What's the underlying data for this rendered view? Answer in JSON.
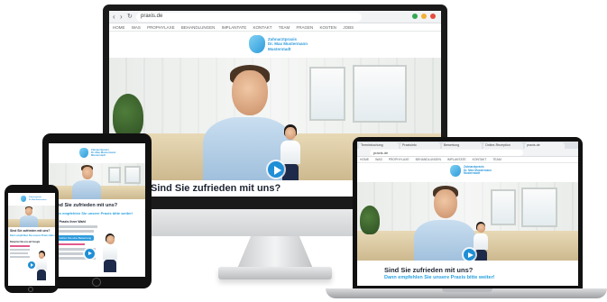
{
  "site": {
    "url": "praxis.de",
    "headline": "Sind Sie zufrieden mit uns?",
    "subline": "Dann empfehlen Sie unsere Praxis bitte weiter!",
    "logo_lines": [
      "Zahnarztpraxis",
      "Dr. Max Mustermann",
      "Musterstadt"
    ],
    "nav_items": [
      "HOME",
      "WAS",
      "PROPHYLAXE",
      "BEHANDLUNGEN",
      "IMPLANTATE",
      "KONTAKT",
      "TEAM",
      "FRAGEN",
      "KOSTEN",
      "JOBS"
    ],
    "cta_label": "Schreiben Sie eine Bewertung",
    "section_title": "Ihre Praxis ihrer Wahl",
    "section_title_2": "Bewerten Sie uns auf Google"
  },
  "macbook_tabs": [
    "Terminbuchung",
    "Praxisinfo",
    "Bewertung",
    "Online-Rezeption",
    "praxis.de"
  ],
  "colors": {
    "accent": "#2f9bdc",
    "headline": "#1d2432",
    "play": "#1f8fd6"
  }
}
